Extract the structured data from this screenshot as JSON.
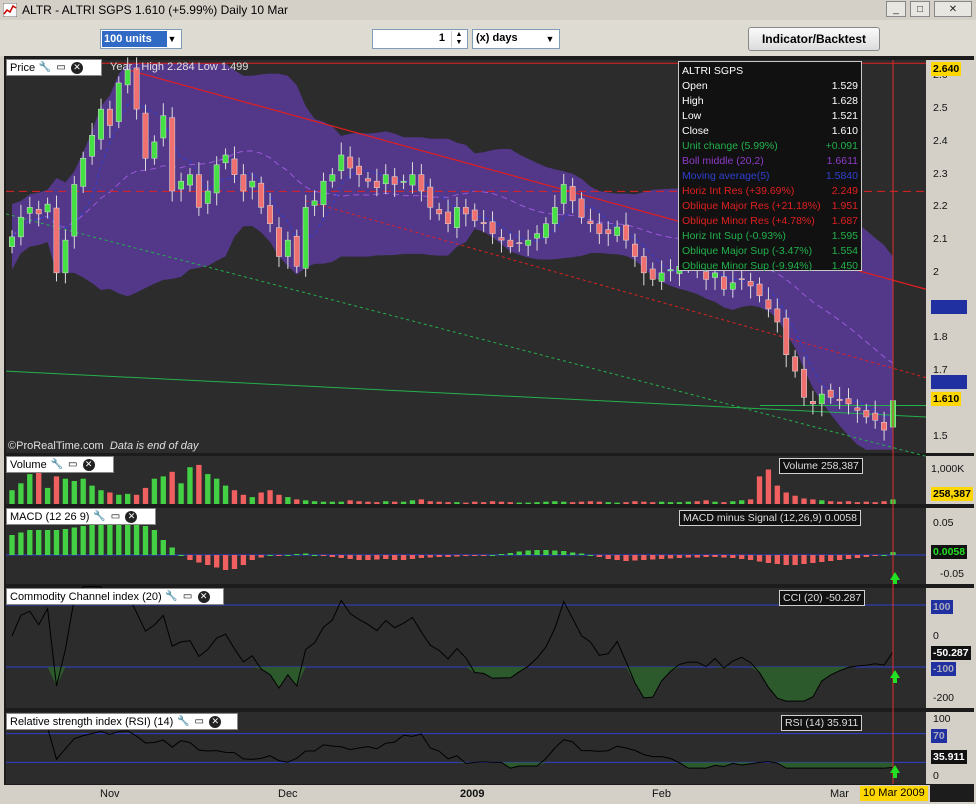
{
  "window": {
    "title": "ALTR - ALTRI SGPS    1.610 (+5.99%)    Daily  10 Mar",
    "buttons": {
      "minimize": "_",
      "maximize": "□",
      "close": "✕"
    }
  },
  "toolbar": {
    "units_value": "100 units",
    "period_count": "1",
    "period_unit": "(x) days",
    "indicator_button": "Indicator/Backtest"
  },
  "price_panel": {
    "label": "Price",
    "year_info": "Year : High 2.284 Low 1.499",
    "credit": "©ProRealTime.com",
    "credit_note": "Data is end of day",
    "y_ticks": [
      "2.6",
      "2.5",
      "2.4",
      "2.3",
      "2.2",
      "2.1",
      "2",
      "1.9",
      "1.8",
      "1.7",
      "1.5"
    ],
    "tag_high": "2.640",
    "tag_close": "1.610",
    "tag_blue_1": "1.9050",
    "tag_blue_2": "1.6818"
  },
  "info_box": {
    "title": "ALTRI SGPS",
    "rows": [
      {
        "label": "Open",
        "value": "1.529",
        "color": "#ffffff"
      },
      {
        "label": "High",
        "value": "1.628",
        "color": "#ffffff"
      },
      {
        "label": "Low",
        "value": "1.521",
        "color": "#ffffff"
      },
      {
        "label": "Close",
        "value": "1.610",
        "color": "#ffffff"
      },
      {
        "label": "Unit change (5.99%)",
        "value": "+0.091",
        "color": "#22b14c"
      },
      {
        "label": "Boll middle (20,2)",
        "value": "1.6611",
        "color": "#8e3bc9"
      },
      {
        "label": "Moving average(5)",
        "value": "1.5840",
        "color": "#3040d0"
      },
      {
        "label": "Horiz Int Res (+39.69%)",
        "value": "2.249",
        "color": "#e02020"
      },
      {
        "label": "Oblique Major Res (+21.18%)",
        "value": "1.951",
        "color": "#e02020"
      },
      {
        "label": "Oblique Minor Res (+4.78%)",
        "value": "1.687",
        "color": "#e02020"
      },
      {
        "label": "Horiz Int Sup (-0.93%)",
        "value": "1.595",
        "color": "#22b14c"
      },
      {
        "label": "Oblique Major Sup (-3.47%)",
        "value": "1.554",
        "color": "#22b14c"
      },
      {
        "label": "Oblique Minor Sup (-9.94%)",
        "value": "1.450",
        "color": "#22b14c"
      }
    ]
  },
  "volume_panel": {
    "label": "Volume",
    "box": "Volume 258,387",
    "y_ticks": [
      "1,000K",
      "500,000"
    ],
    "tag": "258,387"
  },
  "macd_panel": {
    "label": "MACD (12 26 9)",
    "box": "MACD minus Signal (12,26,9) 0.0058",
    "y_ticks": [
      "0.05",
      "0",
      "-0.05"
    ],
    "tag": "0.0058"
  },
  "cci_panel": {
    "label": "Commodity Channel index (20)",
    "box": "CCI (20) -50.287",
    "y_ticks": [
      "100",
      "0",
      "-100",
      "-200"
    ],
    "tag": "-50.287"
  },
  "rsi_panel": {
    "label": "Relative strength index (RSI) (14)",
    "box": "RSI (14) 35.911",
    "y_ticks": [
      "100",
      "70",
      "30",
      "0"
    ],
    "tag": "35.911"
  },
  "x_axis": {
    "labels": [
      "Nov",
      "Dec",
      "2009",
      "Feb",
      "Mar"
    ],
    "current_date": "10 Mar 2009"
  },
  "chart_data": {
    "type": "candlestick",
    "series_note": "ALTRI SGPS daily",
    "y_range": [
      1.45,
      2.65
    ],
    "last": {
      "open": 1.529,
      "high": 1.628,
      "low": 1.521,
      "close": 1.61
    },
    "closes": [
      2.11,
      2.17,
      2.2,
      2.18,
      2.21,
      2.0,
      2.1,
      2.27,
      2.35,
      2.42,
      2.5,
      2.45,
      2.58,
      2.62,
      2.5,
      2.35,
      2.4,
      2.48,
      2.25,
      2.28,
      2.3,
      2.2,
      2.25,
      2.33,
      2.36,
      2.3,
      2.25,
      2.28,
      2.2,
      2.15,
      2.05,
      2.1,
      2.02,
      2.2,
      2.22,
      2.28,
      2.3,
      2.36,
      2.32,
      2.3,
      2.28,
      2.26,
      2.3,
      2.27,
      2.28,
      2.3,
      2.25,
      2.2,
      2.18,
      2.15,
      2.2,
      2.18,
      2.16,
      2.15,
      2.12,
      2.1,
      2.08,
      2.09,
      2.1,
      2.12,
      2.15,
      2.2,
      2.27,
      2.22,
      2.17,
      2.15,
      2.12,
      2.12,
      2.14,
      2.1,
      2.05,
      2.0,
      1.98,
      2.0,
      2.01,
      2.02,
      2.02,
      2.01,
      1.98,
      2.0,
      1.95,
      1.97,
      1.98,
      1.96,
      1.93,
      1.89,
      1.85,
      1.75,
      1.7,
      1.62,
      1.6,
      1.63,
      1.62,
      1.61,
      1.6,
      1.58,
      1.56,
      1.55,
      1.52,
      1.61
    ],
    "volume_percent": [
      30,
      45,
      65,
      70,
      35,
      60,
      55,
      50,
      55,
      40,
      30,
      25,
      20,
      22,
      20,
      35,
      55,
      60,
      70,
      45,
      80,
      85,
      65,
      55,
      40,
      30,
      20,
      15,
      25,
      30,
      20,
      15,
      10,
      8,
      6,
      5,
      5,
      5,
      8,
      6,
      5,
      4,
      6,
      5,
      5,
      8,
      10,
      6,
      5,
      4,
      4,
      3,
      5,
      4,
      6,
      5,
      4,
      3,
      3,
      4,
      5,
      6,
      5,
      4,
      5,
      6,
      5,
      4,
      3,
      4,
      6,
      5,
      4,
      5,
      4,
      4,
      5,
      6,
      8,
      5,
      4,
      6,
      8,
      10,
      60,
      75,
      40,
      25,
      18,
      12,
      10,
      8,
      6,
      5,
      6,
      4,
      5,
      4,
      6,
      10
    ],
    "macd_values": [
      0.04,
      0.045,
      0.05,
      0.05,
      0.05,
      0.05,
      0.052,
      0.055,
      0.058,
      0.06,
      0.06,
      0.062,
      0.063,
      0.063,
      0.06,
      0.058,
      0.05,
      0.03,
      0.015,
      0.0,
      -0.01,
      -0.015,
      -0.02,
      -0.025,
      -0.03,
      -0.028,
      -0.02,
      -0.01,
      -0.005,
      0.0,
      -0.002,
      0.0,
      0.002,
      0.003,
      0.0,
      -0.002,
      -0.004,
      -0.006,
      -0.008,
      -0.01,
      -0.01,
      -0.009,
      -0.008,
      -0.01,
      -0.01,
      -0.008,
      -0.006,
      -0.005,
      -0.004,
      -0.004,
      -0.003,
      -0.002,
      -0.002,
      -0.001,
      0.0,
      0.002,
      0.004,
      0.007,
      0.009,
      0.01,
      0.01,
      0.009,
      0.008,
      0.005,
      0.003,
      0.0,
      -0.004,
      -0.008,
      -0.01,
      -0.012,
      -0.011,
      -0.01,
      -0.009,
      -0.008,
      -0.007,
      -0.006,
      -0.005,
      -0.005,
      -0.004,
      -0.004,
      -0.005,
      -0.006,
      -0.008,
      -0.01,
      -0.013,
      -0.016,
      -0.018,
      -0.02,
      -0.02,
      -0.018,
      -0.016,
      -0.014,
      -0.012,
      -0.01,
      -0.008,
      -0.006,
      -0.004,
      -0.002,
      0.0,
      0.0058
    ]
  }
}
